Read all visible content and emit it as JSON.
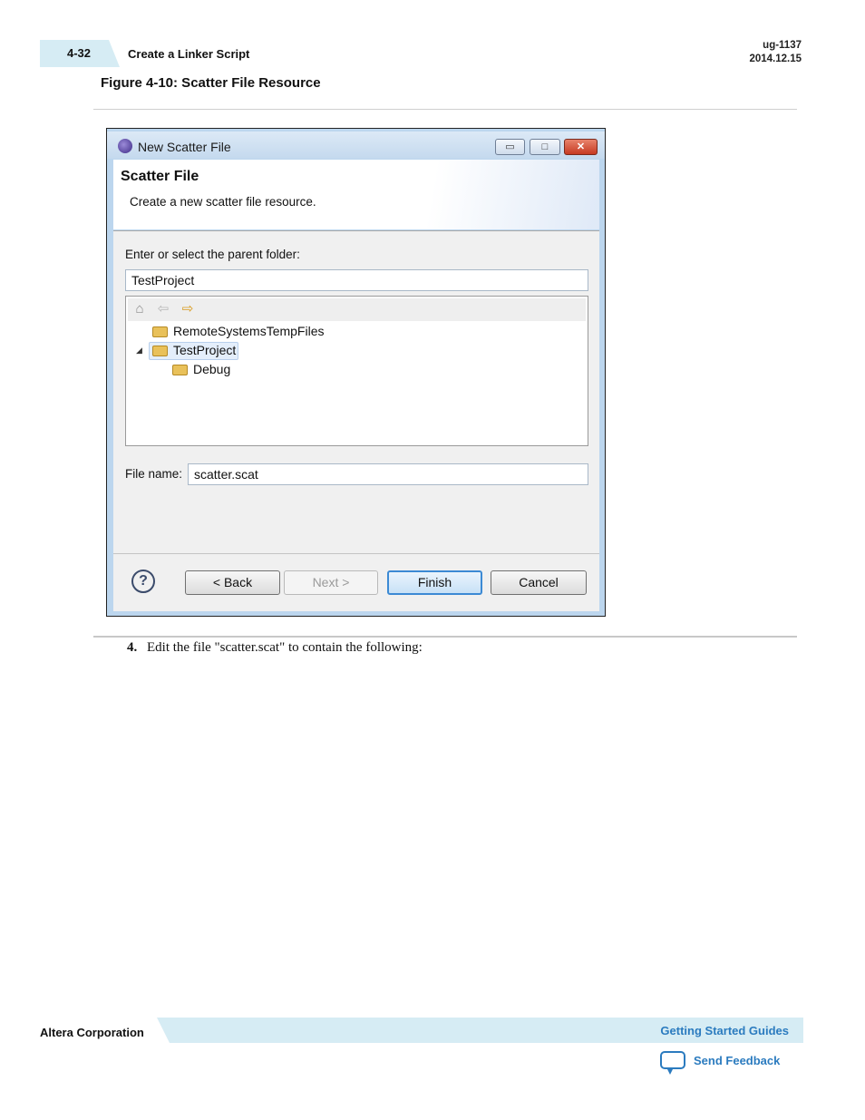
{
  "header": {
    "page_number": "4-32",
    "section_title": "Create a Linker Script",
    "doc_id": "ug-1137",
    "doc_date": "2014.12.15"
  },
  "figure": {
    "caption": "Figure 4-10: Scatter File Resource"
  },
  "dialog": {
    "window_title": "New Scatter File",
    "window_buttons": {
      "minimize": "▭",
      "maximize": "□",
      "close": "✕"
    },
    "banner_title": "Scatter File",
    "banner_description": "Create a new scatter file resource.",
    "parent_folder_label": "Enter or select the parent folder:",
    "parent_folder_value": "TestProject",
    "tree_toolbar_icons": [
      "home-icon",
      "back-arrow-icon",
      "forward-arrow-icon"
    ],
    "tree_items": [
      {
        "label": "RemoteSystemsTempFiles",
        "icon": "folder-icon",
        "expanded": false
      },
      {
        "label": "TestProject",
        "icon": "project-folder-icon",
        "expanded": true,
        "selected": true
      },
      {
        "label": "Debug",
        "icon": "folder-icon",
        "expanded": false
      }
    ],
    "file_name_label": "File name:",
    "file_name_value": "scatter.scat",
    "buttons": {
      "help": "?",
      "back": "< Back",
      "next": "Next >",
      "finish": "Finish",
      "cancel": "Cancel"
    }
  },
  "body": {
    "step_number": "4.",
    "step_text": "Edit the file \"scatter.scat\" to contain the following:"
  },
  "footer": {
    "company": "Altera Corporation",
    "guides_link": "Getting Started Guides",
    "feedback_link": "Send Feedback"
  }
}
